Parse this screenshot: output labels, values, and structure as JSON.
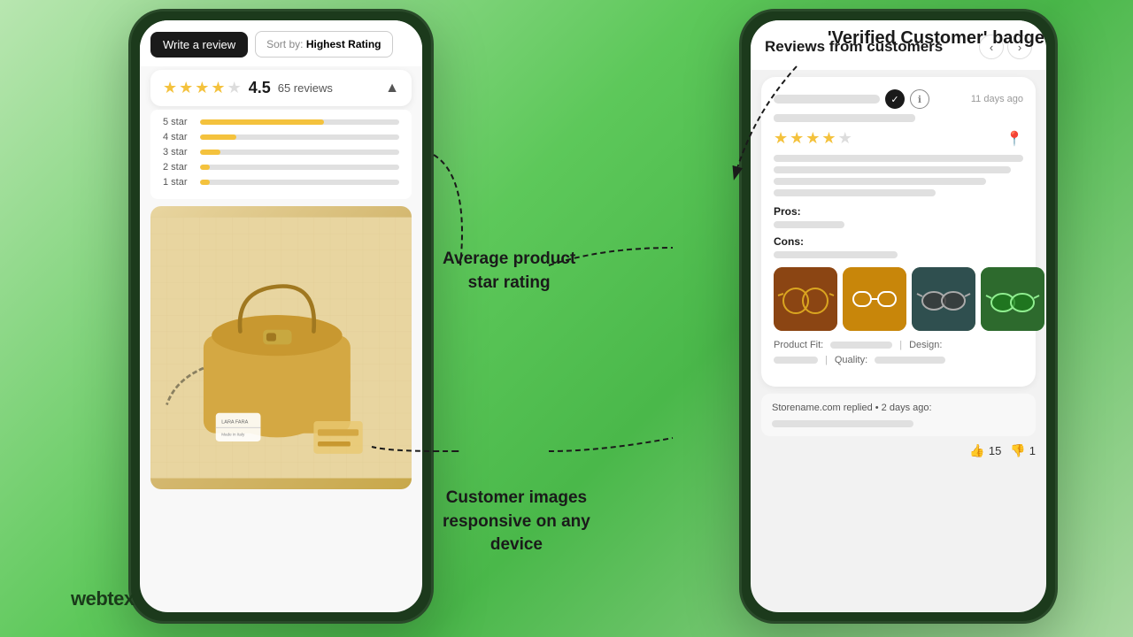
{
  "logo": "webtex",
  "annotation_verified": "'Verified Customer' badge",
  "annotation_avg_rating": "Average product\nstar rating",
  "annotation_customer_images": "Customer images\nresponsive on any\ndevice",
  "left_phone": {
    "write_review_btn": "Write a review",
    "sort_by_label": "Sort by:",
    "sort_value": "Highest Rating",
    "rating": "4.5",
    "reviews_count": "65 reviews",
    "star_bars": [
      {
        "label": "5 star",
        "pct": 62
      },
      {
        "label": "4 star",
        "pct": 18
      },
      {
        "label": "3 star",
        "pct": 10
      },
      {
        "label": "2 star",
        "pct": 5
      },
      {
        "label": "1 star",
        "pct": 5
      }
    ]
  },
  "right_phone": {
    "header_title": "Reviews from customers",
    "review": {
      "date": "11 days ago",
      "rating": 4,
      "pros_label": "Pros:",
      "cons_label": "Cons:",
      "product_fit_label": "Product Fit:",
      "design_label": "Design:",
      "quality_label": "Quality:",
      "store_reply": "Storename.com replied • 2 days ago:",
      "helpful_count": "15",
      "unhelpful_count": "1"
    }
  }
}
